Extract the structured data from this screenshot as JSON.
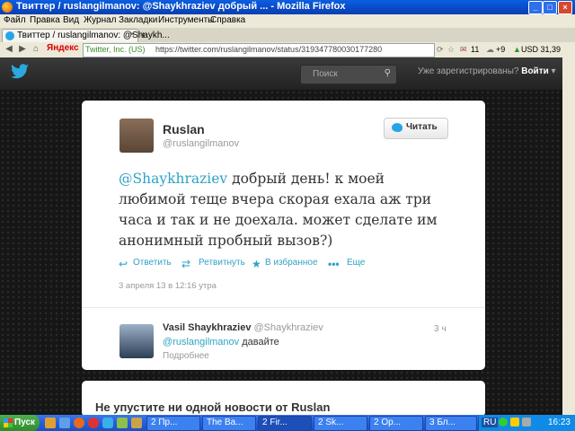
{
  "window": {
    "title": "Твиттер / ruslangilmanov: @Shaykhraziev добрый ... - Mozilla Firefox"
  },
  "menu": [
    "Файл",
    "Правка",
    "Вид",
    "Журнал",
    "Закладки",
    "Инструменты",
    "Справка"
  ],
  "tab": {
    "label": "Твиттер / ruslangilmanov: @Shaykh...",
    "new": "+"
  },
  "nav": {
    "yandex": "Яндекс",
    "site": "Twitter, Inc. (US)",
    "url": "https://twitter.com/ruslangilmanov/status/319347780030177280",
    "indicators": [
      "11",
      "+9",
      "USD 31,39"
    ]
  },
  "twitter": {
    "search_placeholder": "Поиск",
    "signin_prompt": "Уже зарегистрированы?",
    "signin_button": "Войти"
  },
  "tweet": {
    "user_name": "Ruslan",
    "user_handle": "@ruslangilmanov",
    "follow_label": "Читать",
    "mention": "@Shaykhraziev",
    "text": " добрый день! к моей любимой теще вчера скорая ехала аж три часа и так и не доехала. может сделате им анонимный пробный вызов?)",
    "actions": {
      "reply": "Ответить",
      "retweet": "Ретвитнуть",
      "favorite": "В избранное",
      "more": "Еще"
    },
    "timestamp": "3 апреля 13 в 12:16 утра"
  },
  "reply": {
    "name": "Vasil Shaykhraziev",
    "handle": "@Shaykhraziev",
    "time": "3 ч",
    "mention": "@ruslangilmanov",
    "text": " давайте",
    "more": "Подробнее"
  },
  "promo": {
    "text": "Не упустите ни одной новости от Ruslan"
  },
  "taskbar": {
    "start": "Пуск",
    "buttons": [
      "2 Пр...",
      "The Ba...",
      "2 Fir...",
      "2 Sk...",
      "2 Op...",
      "3 Бл..."
    ],
    "lang": "RU",
    "clock": "16:23"
  }
}
